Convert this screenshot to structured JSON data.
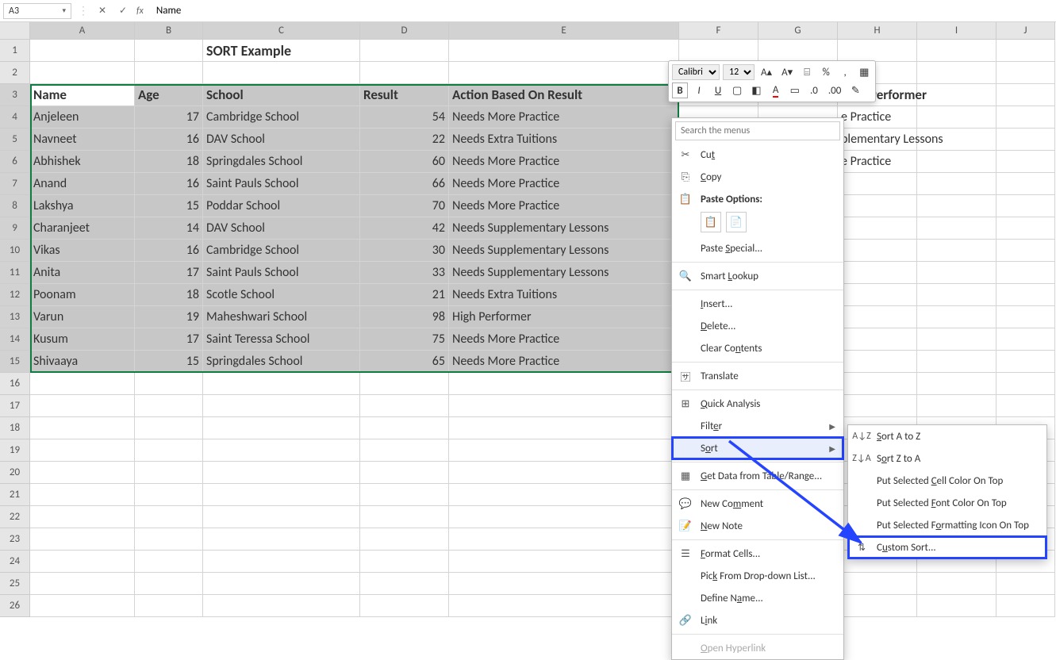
{
  "namebox": "A3",
  "formula_text": "Name",
  "columns": [
    "A",
    "B",
    "C",
    "D",
    "E",
    "F",
    "G",
    "H",
    "I",
    "J"
  ],
  "row_numbers": [
    1,
    2,
    3,
    4,
    5,
    6,
    7,
    8,
    9,
    10,
    11,
    12,
    13,
    14,
    15,
    16,
    17,
    18,
    19,
    20,
    21,
    22,
    23,
    24,
    25,
    26
  ],
  "title": "SORT Example",
  "headers": {
    "a": "Name",
    "b": "Age",
    "c": "School",
    "d": "Result",
    "e": "Action Based On Result"
  },
  "rows": [
    {
      "a": "Anjeleen",
      "b": 17,
      "c": "Cambridge School",
      "d": 54,
      "e": "Needs More Practice"
    },
    {
      "a": "Navneet",
      "b": 16,
      "c": "DAV School",
      "d": 22,
      "e": "Needs Extra Tuitions"
    },
    {
      "a": "Abhishek",
      "b": 18,
      "c": "Springdales School",
      "d": 60,
      "e": "Needs More Practice"
    },
    {
      "a": "Anand",
      "b": 16,
      "c": "Saint Pauls School",
      "d": 66,
      "e": "Needs More Practice"
    },
    {
      "a": "Lakshya",
      "b": 15,
      "c": "Poddar School",
      "d": 70,
      "e": "Needs More Practice"
    },
    {
      "a": "Charanjeet",
      "b": 14,
      "c": "DAV School",
      "d": 42,
      "e": "Needs Supplementary Lessons"
    },
    {
      "a": "Vikas",
      "b": 16,
      "c": "Cambridge School",
      "d": 30,
      "e": "Needs Supplementary Lessons"
    },
    {
      "a": "Anita",
      "b": 17,
      "c": "Saint Pauls School",
      "d": 33,
      "e": "Needs Supplementary Lessons"
    },
    {
      "a": "Poonam",
      "b": 18,
      "c": "Scotle School",
      "d": 21,
      "e": "Needs Extra Tuitions"
    },
    {
      "a": "Varun",
      "b": 19,
      "c": "Maheshwari School",
      "d": 98,
      "e": "High Performer"
    },
    {
      "a": "Kusum",
      "b": 17,
      "c": "Saint Teressa School",
      "d": 75,
      "e": "Needs More Practice"
    },
    {
      "a": "Shivaaya",
      "b": 15,
      "c": "Springdales School",
      "d": 65,
      "e": "Needs More Practice"
    }
  ],
  "peek_rows": [
    "High Performer",
    "e Practice",
    "plementary Lessons",
    "e Practice"
  ],
  "minitoolbar": {
    "font": "Calibri",
    "size": "12"
  },
  "ctx": {
    "search_ph": "Search the menus",
    "cut": "Cut",
    "copy": "Copy",
    "paste_options": "Paste Options:",
    "paste_special": "Paste Special...",
    "smart_lookup": "Smart Lookup",
    "insert": "Insert...",
    "delete": "Delete...",
    "clear": "Clear Contents",
    "translate": "Translate",
    "quick": "Quick Analysis",
    "filter": "Filter",
    "sort": "Sort",
    "getdata": "Get Data from Table/Range...",
    "newcomment": "New Comment",
    "newnote": "New Note",
    "format": "Format Cells...",
    "pick": "Pick From Drop-down List...",
    "define": "Define Name...",
    "link": "Link",
    "open_hl": "Open Hyperlink"
  },
  "submenu": {
    "az": "Sort A to Z",
    "za": "Sort Z to A",
    "cellcolor": "Put Selected Cell Color On Top",
    "fontcolor": "Put Selected Font Color On Top",
    "fmticon": "Put Selected Formatting Icon On Top",
    "custom": "Custom Sort..."
  }
}
